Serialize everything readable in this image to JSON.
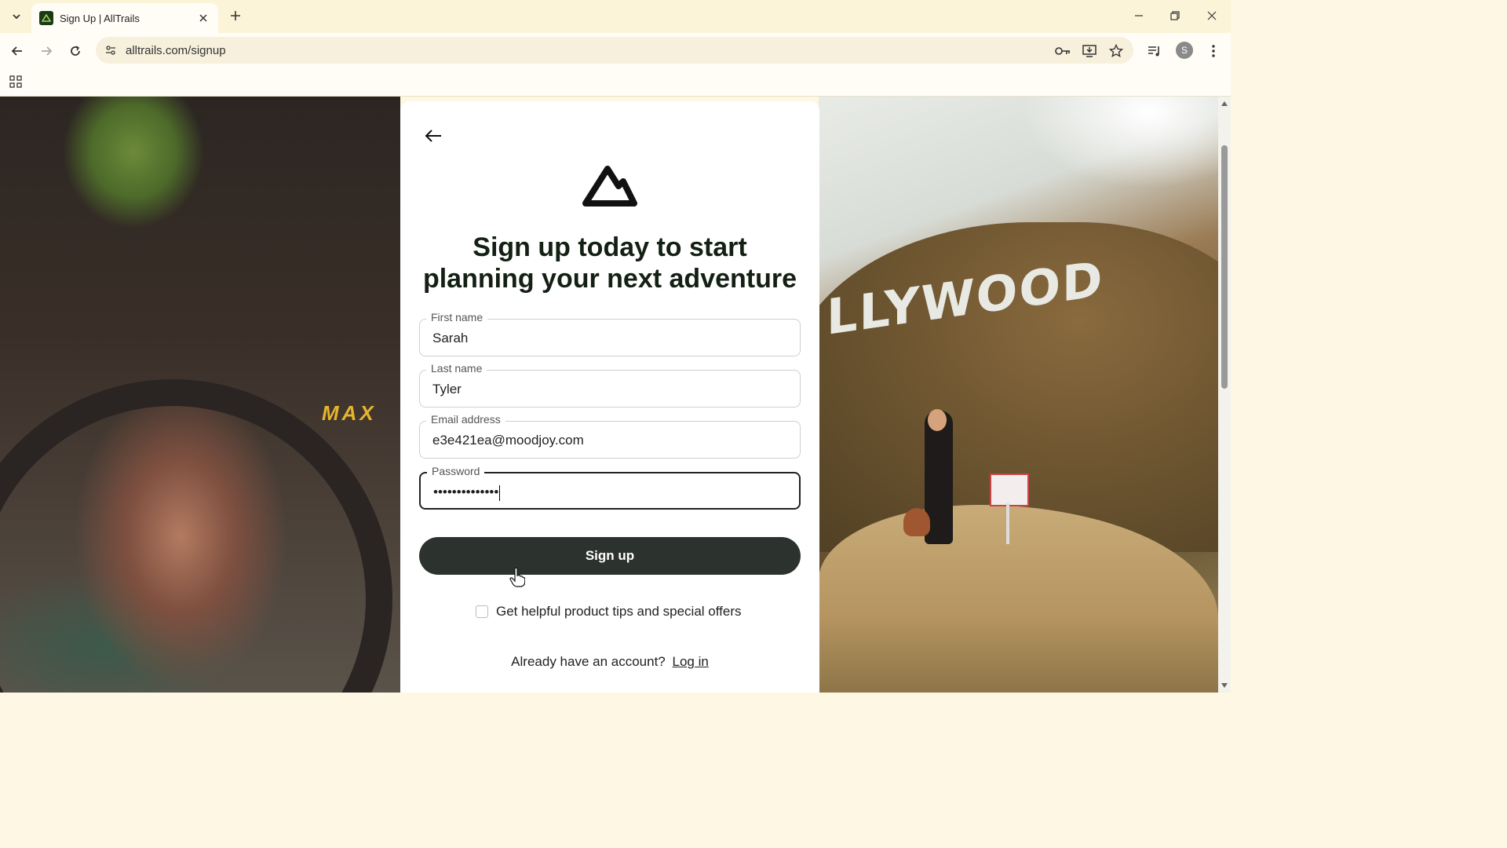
{
  "browser": {
    "tab_title": "Sign Up | AllTrails",
    "url": "alltrails.com/signup",
    "profile_initial": "S"
  },
  "page": {
    "headline": "Sign up today to start planning your next adventure",
    "form": {
      "first_name": {
        "label": "First name",
        "value": "Sarah"
      },
      "last_name": {
        "label": "Last name",
        "value": "Tyler"
      },
      "email": {
        "label": "Email address",
        "value": "e3e421ea@moodjoy.com"
      },
      "password": {
        "label": "Password",
        "value": "••••••••••••••"
      }
    },
    "signup_button": "Sign up",
    "optin_label": "Get helpful product tips and special offers",
    "login_prompt": "Already have an account?",
    "login_link": "Log in",
    "left_photo_text": "MAX",
    "right_photo_text": "LLYWOOD"
  },
  "colors": {
    "button_bg": "#2c322d",
    "chrome_bg": "#fbf4d8",
    "card_bg": "#ffffff"
  }
}
